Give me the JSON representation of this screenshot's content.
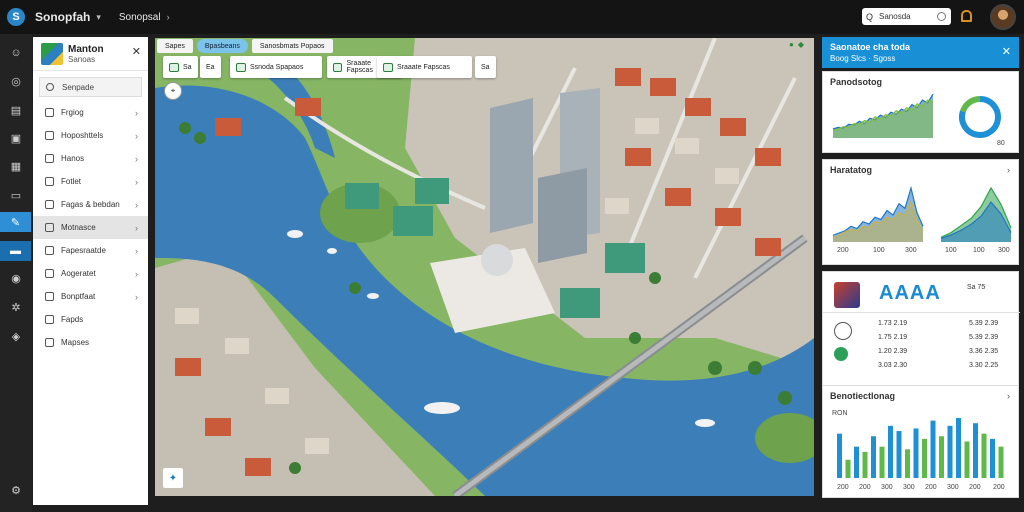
{
  "topbar": {
    "app_title": "Sonopfah",
    "menu_label": "Sonopsal",
    "search": {
      "value": "Sanosda"
    }
  },
  "side": {
    "org_name": "Manton",
    "org_sub": "Sanoas",
    "search_label": "Senpade",
    "items": [
      {
        "label": "Frgiog"
      },
      {
        "label": "Hoposhttels"
      },
      {
        "label": "Hanos"
      },
      {
        "label": "Fotlet"
      },
      {
        "label": "Fagas & bebdan"
      },
      {
        "label": "Motnasce"
      },
      {
        "label": "Fapesraatde"
      },
      {
        "label": "Aogeratet"
      },
      {
        "label": "Bonptfaat"
      },
      {
        "label": "Fapds"
      },
      {
        "label": "Mapses"
      }
    ]
  },
  "map": {
    "tabs": [
      {
        "label": "Sapes"
      },
      {
        "label": "Bpasbeans"
      },
      {
        "label": "Sanosbmats Popaos"
      }
    ],
    "toolbar": [
      {
        "label": "Sa"
      },
      {
        "label": "Ea"
      },
      {
        "label": "Ssnoda Spapaos"
      },
      {
        "label": "Sraaate Fapscas"
      },
      {
        "label": "Sa"
      }
    ]
  },
  "notification": {
    "title": "Saonatoe cha toda",
    "body": "Boog Slcs · Sgoss"
  },
  "card_trends": {
    "title": "Panodsotog",
    "donut_value": "80"
  },
  "card_market": {
    "title": "Haratatog",
    "tick_labels": [
      "200",
      "100",
      "300",
      "100",
      "100",
      "300"
    ]
  },
  "card_stats": {
    "big_label": "AAAA",
    "left_stats": [
      "1.73 2.19",
      "1.75 2.19",
      "1.20 2.39",
      "3.03 2.30"
    ],
    "right_stats": [
      "5.39 2.39",
      "5.39 2.39",
      "3.36 2.35",
      "3.30 2.25"
    ],
    "top_right": "Sa 75"
  },
  "card_bars": {
    "title": "Benotiectlonag",
    "subtitle": "RON",
    "tick_labels": [
      "200",
      "200",
      "300",
      "300",
      "200",
      "300",
      "200",
      "200"
    ]
  },
  "chart_data": [
    {
      "type": "area",
      "x": [
        1,
        2,
        3,
        4,
        5,
        6,
        7,
        8,
        9,
        10,
        11,
        12,
        13,
        14,
        15,
        16,
        17,
        18,
        19,
        20
      ],
      "series": [
        {
          "values": [
            12,
            14,
            13,
            18,
            17,
            22,
            19,
            26,
            24,
            30,
            27,
            34,
            31,
            38,
            35,
            44,
            40,
            50,
            46,
            58
          ]
        },
        {
          "values": [
            10,
            12,
            15,
            14,
            19,
            18,
            23,
            21,
            28,
            25,
            31,
            29,
            36,
            33,
            40,
            37,
            45,
            42,
            50,
            48
          ]
        }
      ]
    },
    {
      "type": "pie",
      "values": [
        80,
        20
      ]
    },
    {
      "type": "area",
      "x": [
        1,
        2,
        3,
        4,
        5,
        6,
        7,
        8,
        9,
        10,
        11,
        12,
        13,
        14,
        15,
        16
      ],
      "series": [
        {
          "values": [
            6,
            8,
            10,
            14,
            12,
            18,
            16,
            22,
            20,
            28,
            24,
            34,
            30,
            48,
            26,
            14
          ]
        },
        {
          "values": [
            4,
            6,
            9,
            11,
            10,
            14,
            13,
            18,
            17,
            22,
            20,
            26,
            24,
            36,
            20,
            10
          ]
        }
      ]
    },
    {
      "type": "area",
      "x": [
        1,
        2,
        3,
        4,
        5,
        6,
        7,
        8
      ],
      "series": [
        {
          "values": [
            4,
            8,
            14,
            20,
            30,
            46,
            32,
            12
          ]
        },
        {
          "values": [
            3,
            6,
            10,
            15,
            22,
            34,
            24,
            8
          ]
        }
      ]
    },
    {
      "type": "bar",
      "categories": [
        "1",
        "2",
        "3",
        "4",
        "5",
        "6",
        "7",
        "8",
        "9",
        "10",
        "11",
        "12",
        "13",
        "14",
        "15",
        "16",
        "17",
        "18",
        "19",
        "20"
      ],
      "series": [
        {
          "values": [
            34,
            0,
            24,
            0,
            32,
            0,
            40,
            36,
            0,
            38,
            0,
            44,
            0,
            40,
            46,
            0,
            42,
            0,
            30,
            0
          ]
        },
        {
          "values": [
            0,
            14,
            0,
            20,
            0,
            24,
            0,
            0,
            22,
            0,
            30,
            0,
            32,
            0,
            0,
            28,
            0,
            34,
            0,
            24
          ]
        }
      ]
    }
  ]
}
